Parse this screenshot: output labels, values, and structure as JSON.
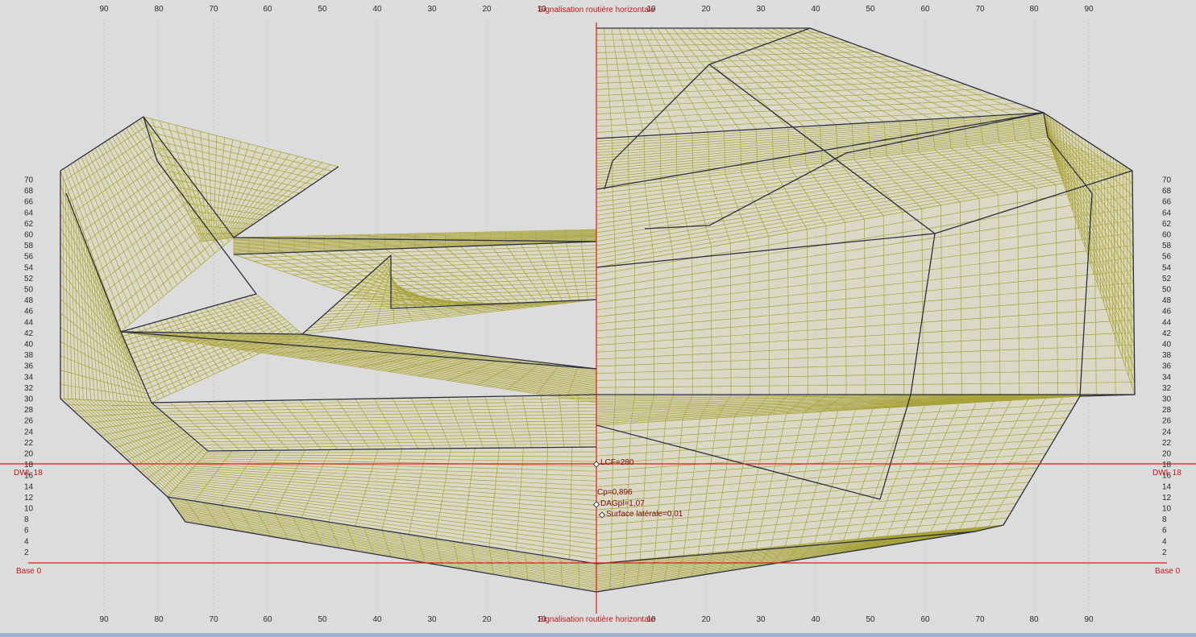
{
  "title_top": "Signalisation routière horizontale",
  "title_bottom": "Signalisation routière horizontale",
  "x_ticks_left": [
    "90",
    "80",
    "70",
    "60",
    "50",
    "40",
    "30",
    "20",
    "10"
  ],
  "x_ticks_right": [
    "10",
    "20",
    "30",
    "40",
    "50",
    "60",
    "70",
    "80",
    "90"
  ],
  "y_ticks": [
    "70",
    "68",
    "66",
    "64",
    "62",
    "60",
    "58",
    "56",
    "54",
    "52",
    "50",
    "48",
    "46",
    "44",
    "42",
    "40",
    "38",
    "36",
    "34",
    "32",
    "30",
    "28",
    "26",
    "24",
    "22",
    "20",
    "18",
    "16",
    "14",
    "12",
    "10",
    "8",
    "6",
    "4",
    "2"
  ],
  "waterline_label": "DWL 18",
  "baseline_label": "Base 0",
  "annotations": {
    "lcf": "LCF=280",
    "cp": "Cp=0,896",
    "dag": "DAGpl=1,07",
    "surface": "Surface latérale=0,01"
  },
  "colors": {
    "background": "#dcdcdc",
    "mesh": "#a8a23a",
    "mesh_fill": "#d9d49a",
    "edges": "#2b2f3d",
    "reference_lines": "#e21b1b",
    "grid": "#8fc9c9",
    "axis_text": "#2a2a2a",
    "statusbar": "#9fb3cf"
  },
  "icons": [
    "marker-icon"
  ]
}
